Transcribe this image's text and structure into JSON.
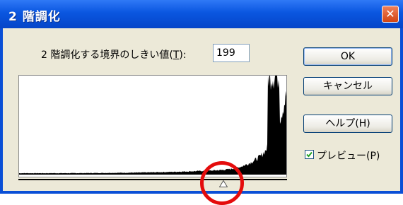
{
  "window": {
    "title": "2 階調化"
  },
  "title_bar": {
    "close_label": "✕"
  },
  "threshold": {
    "label_prefix": "2 階調化する境界のしきい値(",
    "label_key": "T",
    "label_suffix": "):",
    "value": "199"
  },
  "buttons": {
    "ok": "OK",
    "cancel": "キャンセル",
    "help": "ヘルプ(H)"
  },
  "preview": {
    "checked": true,
    "label": "プレビュー(P)"
  },
  "histogram": {
    "slider_value": 199,
    "slider_max": 255
  },
  "colors": {
    "title_bar": "#0a56e0",
    "dialog_bg": "#ece9d8",
    "highlight": "#e40c0c"
  },
  "icons": {
    "close": "close-icon",
    "slider": "slider-thumb-icon",
    "check": "check-icon"
  }
}
